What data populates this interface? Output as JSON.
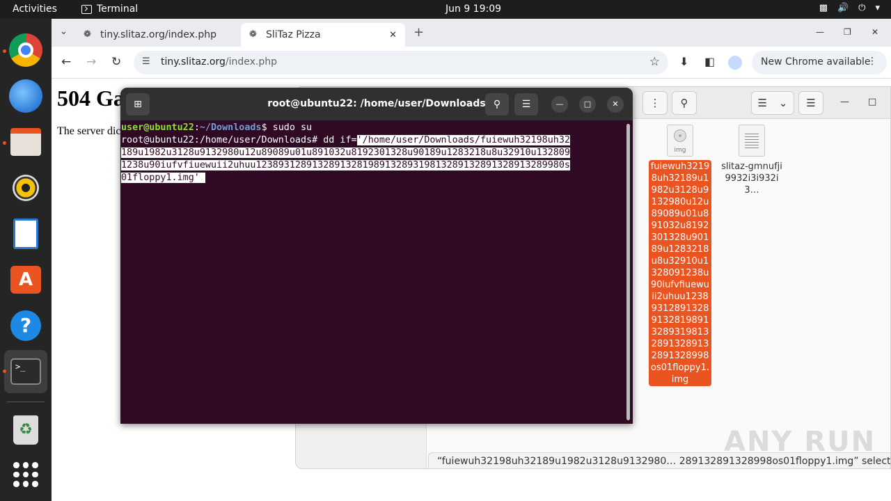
{
  "topbar": {
    "activities": "Activities",
    "app_name": "Terminal",
    "clock": "Jun 9  19:09",
    "tray": [
      "network-icon",
      "volume-icon",
      "power-icon",
      "chevron-down-icon"
    ]
  },
  "dock": {
    "items": [
      "chrome-icon",
      "thunderbird-icon",
      "files-icon",
      "rhythmbox-icon",
      "writer-icon",
      "app-center-icon",
      "help-icon",
      "terminal-icon",
      "trash-icon",
      "show-apps-icon"
    ]
  },
  "chrome": {
    "tabs": [
      {
        "title": "tiny.slitaz.org/index.php"
      },
      {
        "title": "SliTaz Pizza"
      }
    ],
    "url_host": "tiny.slitaz.org",
    "url_path": "/index.php",
    "update_label": "New Chrome available",
    "page": {
      "heading": "504 Ga",
      "body": "The server dic"
    }
  },
  "files": {
    "items": [
      {
        "name": "fuiewuh32198uh32189u1982u3128u9132980u12u89089u01u891032u8192301328u90189u1283218u8u32910u1328091238u90iufvfiuewuii2uhuu123893128913289132819891328931981328913289132891328998os01floppy1.img",
        "icon_label": "img",
        "selected": true
      },
      {
        "name": "slitaz-gmnufji9932i3i932i3…",
        "selected": false
      }
    ],
    "status": "“fuiewuh32198uh32189u1982u3128u9132980… 289132891328998os01floppy1.img” selected  (1.5 M"
  },
  "terminal": {
    "title": "root@ubuntu22: /home/user/Downloads",
    "line1_user": "user@ubuntu22",
    "line1_sep": ":",
    "line1_path": "~/Downloads",
    "line1_cmd": "$ sudo su",
    "line2_prompt": "root@ubuntu22:/home/user/Downloads# dd if=",
    "line2_sel_start": "'/home/user/Downloads/fuiewuh32198uh32",
    "line3": "189u1982u3128u9132980u12u89089u01u891032u8192301328u90189u1283218u8u32910u132809",
    "line4": "1238u90iufvfiuewuii2uhuu1238931289132891328198913289319813289132891328913289980s",
    "line5": "01floppy1.img' "
  },
  "watermark": "ANY RUN"
}
